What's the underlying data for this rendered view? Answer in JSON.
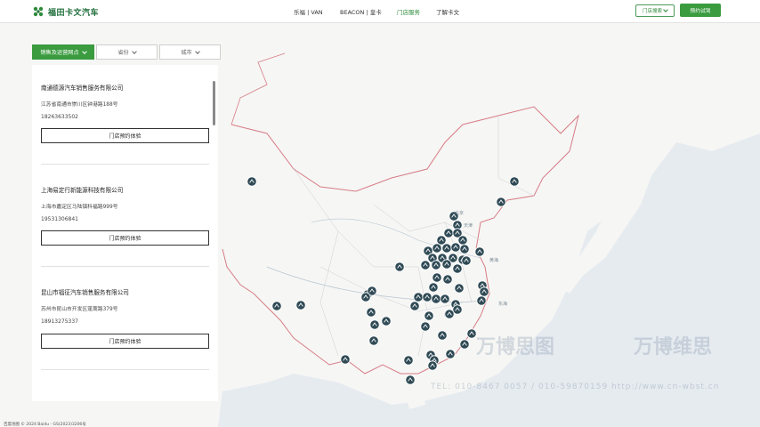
{
  "header": {
    "logo_text": "福田卡文汽车",
    "nav": [
      "乐福 | VAN",
      "BEACON | 皇卡",
      "门店服务",
      "了解卡文"
    ],
    "active_nav": "门店服务",
    "city_select": "门店搜索",
    "test_drive": "预约试驾",
    "accent": "#3a9b3f"
  },
  "filters": {
    "type": "销售及运营网点",
    "province": "省份",
    "city": "城市"
  },
  "dealers": [
    {
      "name": "南通德源汽车销售服务有限公司",
      "address": "江苏省南通市崇川区钟港路188号",
      "phone": "18263633502",
      "button": "门店预约体验"
    },
    {
      "name": "上海易定行新能源科技有限公司",
      "address": "上海市嘉定区马陆镇科福路999号",
      "phone": "19531306841",
      "button": "门店预约体验"
    },
    {
      "name": "昆山市福征汽车销售服务有限公司",
      "address": "苏州市昆山市开发区蓬蒿路379号",
      "phone": "18913275337",
      "button": "门店预约体验"
    }
  ],
  "map": {
    "labels": [
      "北京",
      "天津",
      "黄海",
      "东海"
    ],
    "footer": "百度地图 © 2024 Baidu - GS(2023)3206号",
    "marker_color": "#2f4a55"
  },
  "watermark": {
    "left": "万博思图",
    "right": "万博维思",
    "contact": "TEL: 010-8467 0057 / 010-59870159   http://www.cn-wbst.cn"
  }
}
